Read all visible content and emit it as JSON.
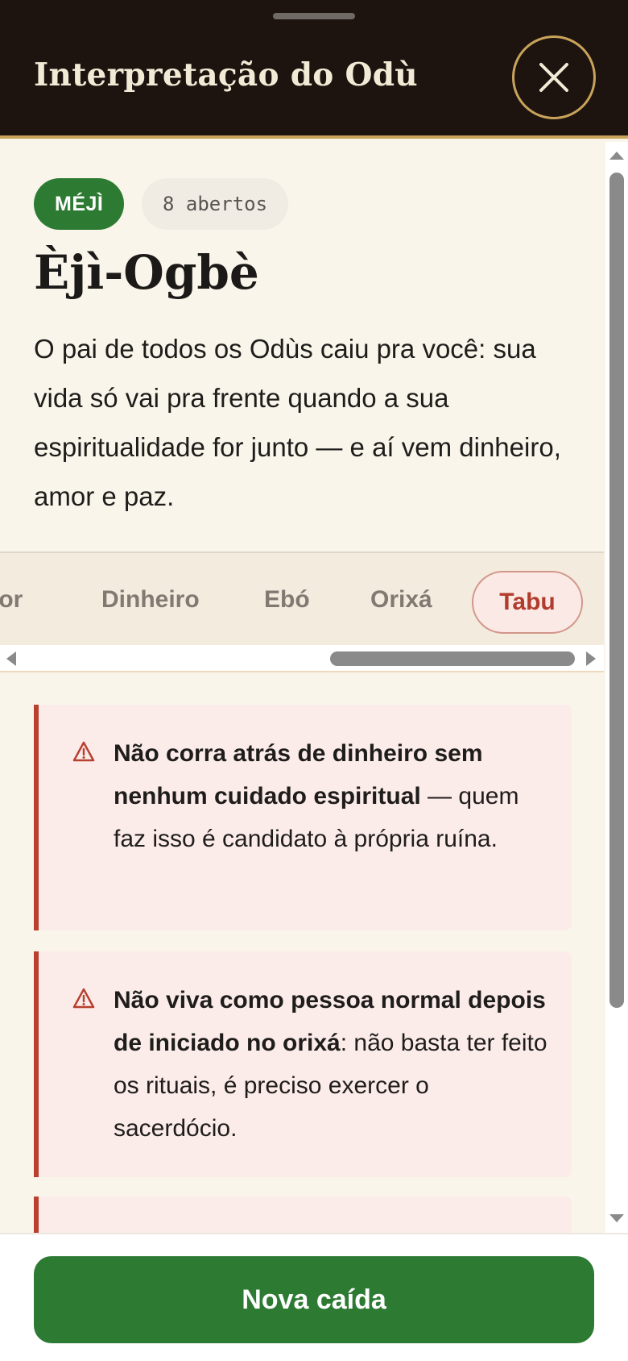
{
  "header": {
    "title": "Interpretação do Odù",
    "close_icon": "close-icon"
  },
  "odu": {
    "badge": "MÉJÌ",
    "opened_count": "8 abertos",
    "name": "Èjì-Ogbè",
    "summary": "O pai de todos os Odùs caiu pra você: sua vida só vai pra frente quando a sua espiritualidade for junto — e aí vem dinheiro, amor e paz."
  },
  "tabs": {
    "items": [
      "Amor",
      "Dinheiro",
      "Ebó",
      "Orixá",
      "Tabu"
    ],
    "active": "Tabu"
  },
  "taboos": [
    {
      "bold": "Não corra atrás de dinheiro sem nenhum cuidado espiritual",
      "rest": " — quem faz isso é candidato à própria ruína."
    },
    {
      "bold": "Não viva como pessoa normal depois de iniciado no orixá",
      "rest": ": não basta ter feito os rituais, é preciso exercer o sacerdócio."
    }
  ],
  "footer": {
    "cta_label": "Nova caída"
  },
  "colors": {
    "accent_green": "#2d7b33",
    "header_bg": "#1d1410",
    "gold": "#c9a35a",
    "taboo_red": "#b8402f"
  }
}
